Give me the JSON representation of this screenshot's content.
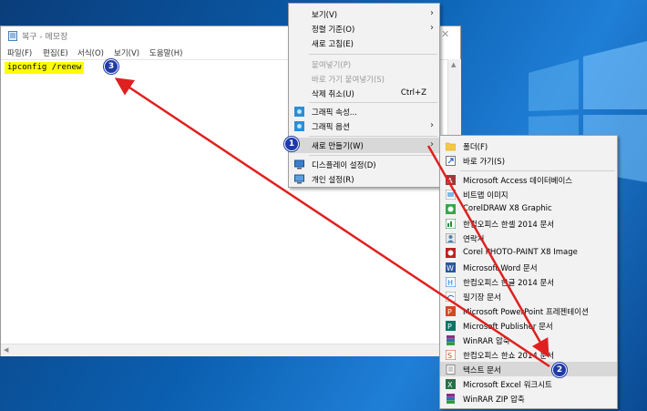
{
  "notepad": {
    "title": "복구 - 메모장",
    "close": "✕",
    "menu": [
      "파일(F)",
      "편집(E)",
      "서식(O)",
      "보기(V)",
      "도움말(H)"
    ],
    "content": "ipconfig /renew"
  },
  "context_menu": {
    "items": [
      {
        "label": "보기(V)",
        "submenu": true
      },
      {
        "label": "정렬 기준(O)",
        "submenu": true
      },
      {
        "label": "새로 고침(E)"
      },
      {
        "label": "붙여넣기(P)",
        "disabled": true
      },
      {
        "label": "바로 가기 붙여넣기(S)",
        "disabled": true
      },
      {
        "label": "삭제 취소(U)",
        "shortcut": "Ctrl+Z"
      },
      {
        "label": "그래픽 속성..."
      },
      {
        "label": "그래픽 옵션",
        "submenu": true
      },
      {
        "label": "새로 만들기(W)",
        "submenu": true,
        "highlighted": true
      },
      {
        "label": "디스플레이 설정(D)"
      },
      {
        "label": "개인 설정(R)"
      }
    ]
  },
  "new_submenu": {
    "items": [
      {
        "label": "폴더(F)",
        "icon": "folder-icon"
      },
      {
        "label": "바로 가기(S)",
        "icon": "shortcut-icon"
      },
      {
        "label": "Microsoft Access 데이터베이스",
        "icon": "access-icon"
      },
      {
        "label": "비트맵 이미지",
        "icon": "bitmap-icon"
      },
      {
        "label": "CorelDRAW X8 Graphic",
        "icon": "coreldraw-icon"
      },
      {
        "label": "한컴오피스 한셀 2014 문서",
        "icon": "hancell-icon"
      },
      {
        "label": "연락처",
        "icon": "contact-icon"
      },
      {
        "label": "Corel PHOTO-PAINT X8 Image",
        "icon": "photopaint-icon"
      },
      {
        "label": "Microsoft Word 문서",
        "icon": "word-icon"
      },
      {
        "label": "한컴오피스 한글 2014 문서",
        "icon": "hwp-icon"
      },
      {
        "label": "필기장 문서",
        "icon": "journal-icon"
      },
      {
        "label": "Microsoft PowerPoint 프레젠테이션",
        "icon": "powerpoint-icon"
      },
      {
        "label": "Microsoft Publisher 문서",
        "icon": "publisher-icon"
      },
      {
        "label": "WinRAR 압축",
        "icon": "winrar-icon"
      },
      {
        "label": "한컴오피스 한쇼 2014 문서",
        "icon": "hanshow-icon"
      },
      {
        "label": "텍스트 문서",
        "icon": "text-document-icon",
        "highlighted": true
      },
      {
        "label": "Microsoft Excel 워크시트",
        "icon": "excel-icon"
      },
      {
        "label": "WinRAR ZIP 압축",
        "icon": "winrar-zip-icon"
      }
    ]
  },
  "badges": [
    "1",
    "2",
    "3"
  ],
  "colors": {
    "arrow": "#e02020",
    "badge": "#1e3aa8",
    "highlight_text": "#ffff00",
    "menu_bg": "#f2f2f2",
    "menu_hover": "#d8d8d8"
  }
}
